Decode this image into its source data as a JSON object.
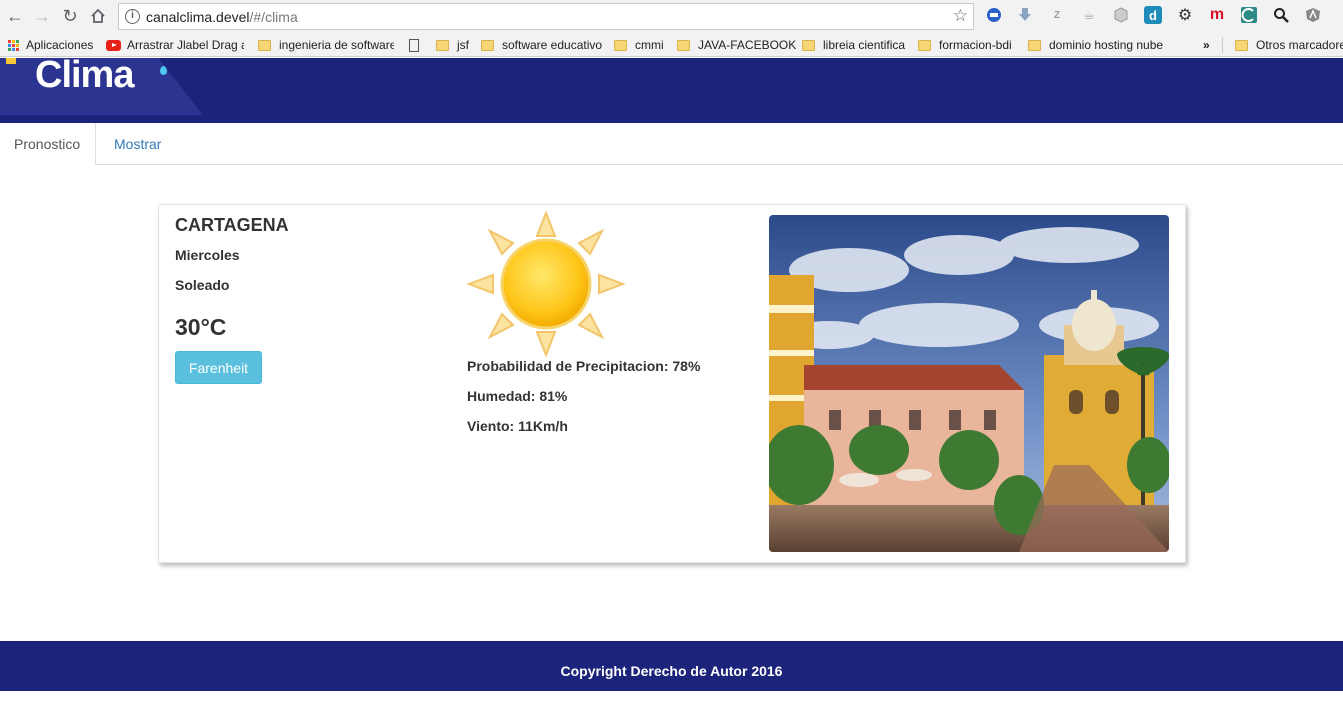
{
  "browser": {
    "url_host": "canalclima.devel",
    "url_path": "/#/clima",
    "bookmarks": [
      {
        "label": "Aplicaciones",
        "icon": "apps-grid-icon"
      },
      {
        "label": "Arrastrar Jlabel Drag a",
        "icon": "youtube-icon"
      },
      {
        "label": "ingenieria de software",
        "icon": "folder-icon"
      },
      {
        "label": "",
        "icon": "page-icon"
      },
      {
        "label": "jsf",
        "icon": "folder-icon"
      },
      {
        "label": "software educativo",
        "icon": "folder-icon"
      },
      {
        "label": "cmmi",
        "icon": "folder-icon"
      },
      {
        "label": "JAVA-FACEBOOK",
        "icon": "folder-icon"
      },
      {
        "label": "libreia cientifica",
        "icon": "folder-icon"
      },
      {
        "label": "formacion-bdi",
        "icon": "folder-icon"
      },
      {
        "label": "dominio hosting nube",
        "icon": "folder-icon"
      }
    ],
    "overflow_label": "»",
    "other_bookmarks": "Otros marcadores",
    "ext_icons": {
      "d": "d",
      "m": "m"
    }
  },
  "header": {
    "logo": "Clima"
  },
  "tabs": [
    {
      "label": "Pronostico",
      "active": true
    },
    {
      "label": "Mostrar",
      "active": false
    }
  ],
  "weather": {
    "city": "CARTAGENA",
    "day": "Miercoles",
    "condition": "Soleado",
    "temperature": "30°C",
    "unit_button": "Farenheit",
    "precipitation": "Probabilidad de Precipitacion: 78%",
    "humidity": "Humedad: 81%",
    "wind": "Viento: 11Km/h"
  },
  "footer": {
    "text": "Copyright Derecho de Autor 2016"
  },
  "colors": {
    "header": "#1b237b",
    "button": "#5bc0de",
    "link": "#337ab7"
  }
}
